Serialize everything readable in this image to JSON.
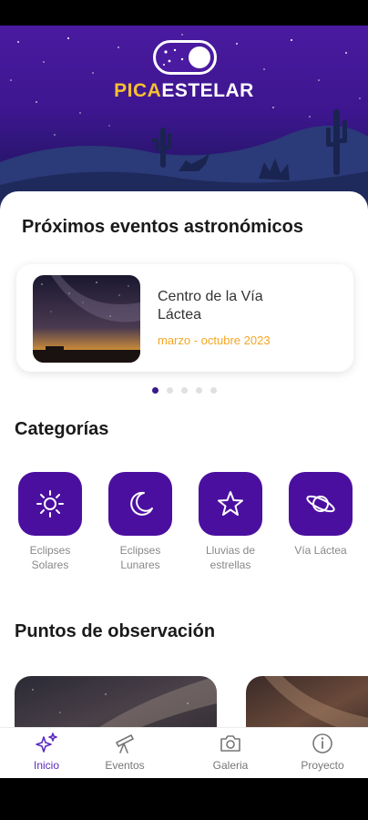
{
  "brand": {
    "part1": "PICA",
    "part2": "ESTELAR"
  },
  "events": {
    "heading": "Próximos eventos astronómicos",
    "items": [
      {
        "title": "Centro de la Vía Láctea",
        "date": "marzo - octubre 2023"
      }
    ],
    "pages": 5,
    "active_page": 1
  },
  "categories": {
    "heading": "Categorías",
    "items": [
      {
        "label": "Eclipses Solares",
        "icon": "sun-icon"
      },
      {
        "label": "Eclipses Lunares",
        "icon": "moon-icon"
      },
      {
        "label": "Lluvias de estrellas",
        "icon": "star-icon"
      },
      {
        "label": "Vía Láctea",
        "icon": "planet-icon"
      }
    ]
  },
  "observation": {
    "heading": "Puntos de observación"
  },
  "nav": {
    "items": [
      {
        "label": "Inicio",
        "icon": "sparkle-icon",
        "active": true
      },
      {
        "label": "Eventos",
        "icon": "telescope-icon",
        "active": false
      },
      {
        "label": "Galeria",
        "icon": "camera-icon",
        "active": false
      },
      {
        "label": "Proyecto",
        "icon": "info-icon",
        "active": false
      }
    ]
  },
  "colors": {
    "primary": "#4b0fa0",
    "accent": "#f5c030",
    "date": "#f5a623",
    "nav_active": "#5a2ac0"
  }
}
